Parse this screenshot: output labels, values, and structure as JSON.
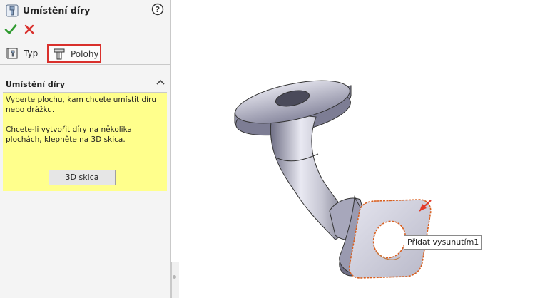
{
  "panel": {
    "title": "Umístění díry",
    "feature_icon": "hole-wizard-icon",
    "help_icon": "help-icon",
    "ok_icon": "checkmark-icon",
    "cancel_icon": "close-icon",
    "tabs": [
      {
        "label": "Typ",
        "icon": "hole-type-icon",
        "active": false
      },
      {
        "label": "Polohy",
        "icon": "hole-position-icon",
        "active": true
      }
    ],
    "section": {
      "title": "Umístění díry",
      "message_line1": "Vyberte plochu, kam chcete umístit díru nebo drážku.",
      "message_line2": "Chcete-li vytvořit díry na několika plochách, klepněte na 3D skica.",
      "button_label": "3D skica"
    }
  },
  "viewport": {
    "tooltip": "Přidat vysunutím1",
    "highlight_color": "#d9302c",
    "message_bg": "#ffff8c"
  }
}
